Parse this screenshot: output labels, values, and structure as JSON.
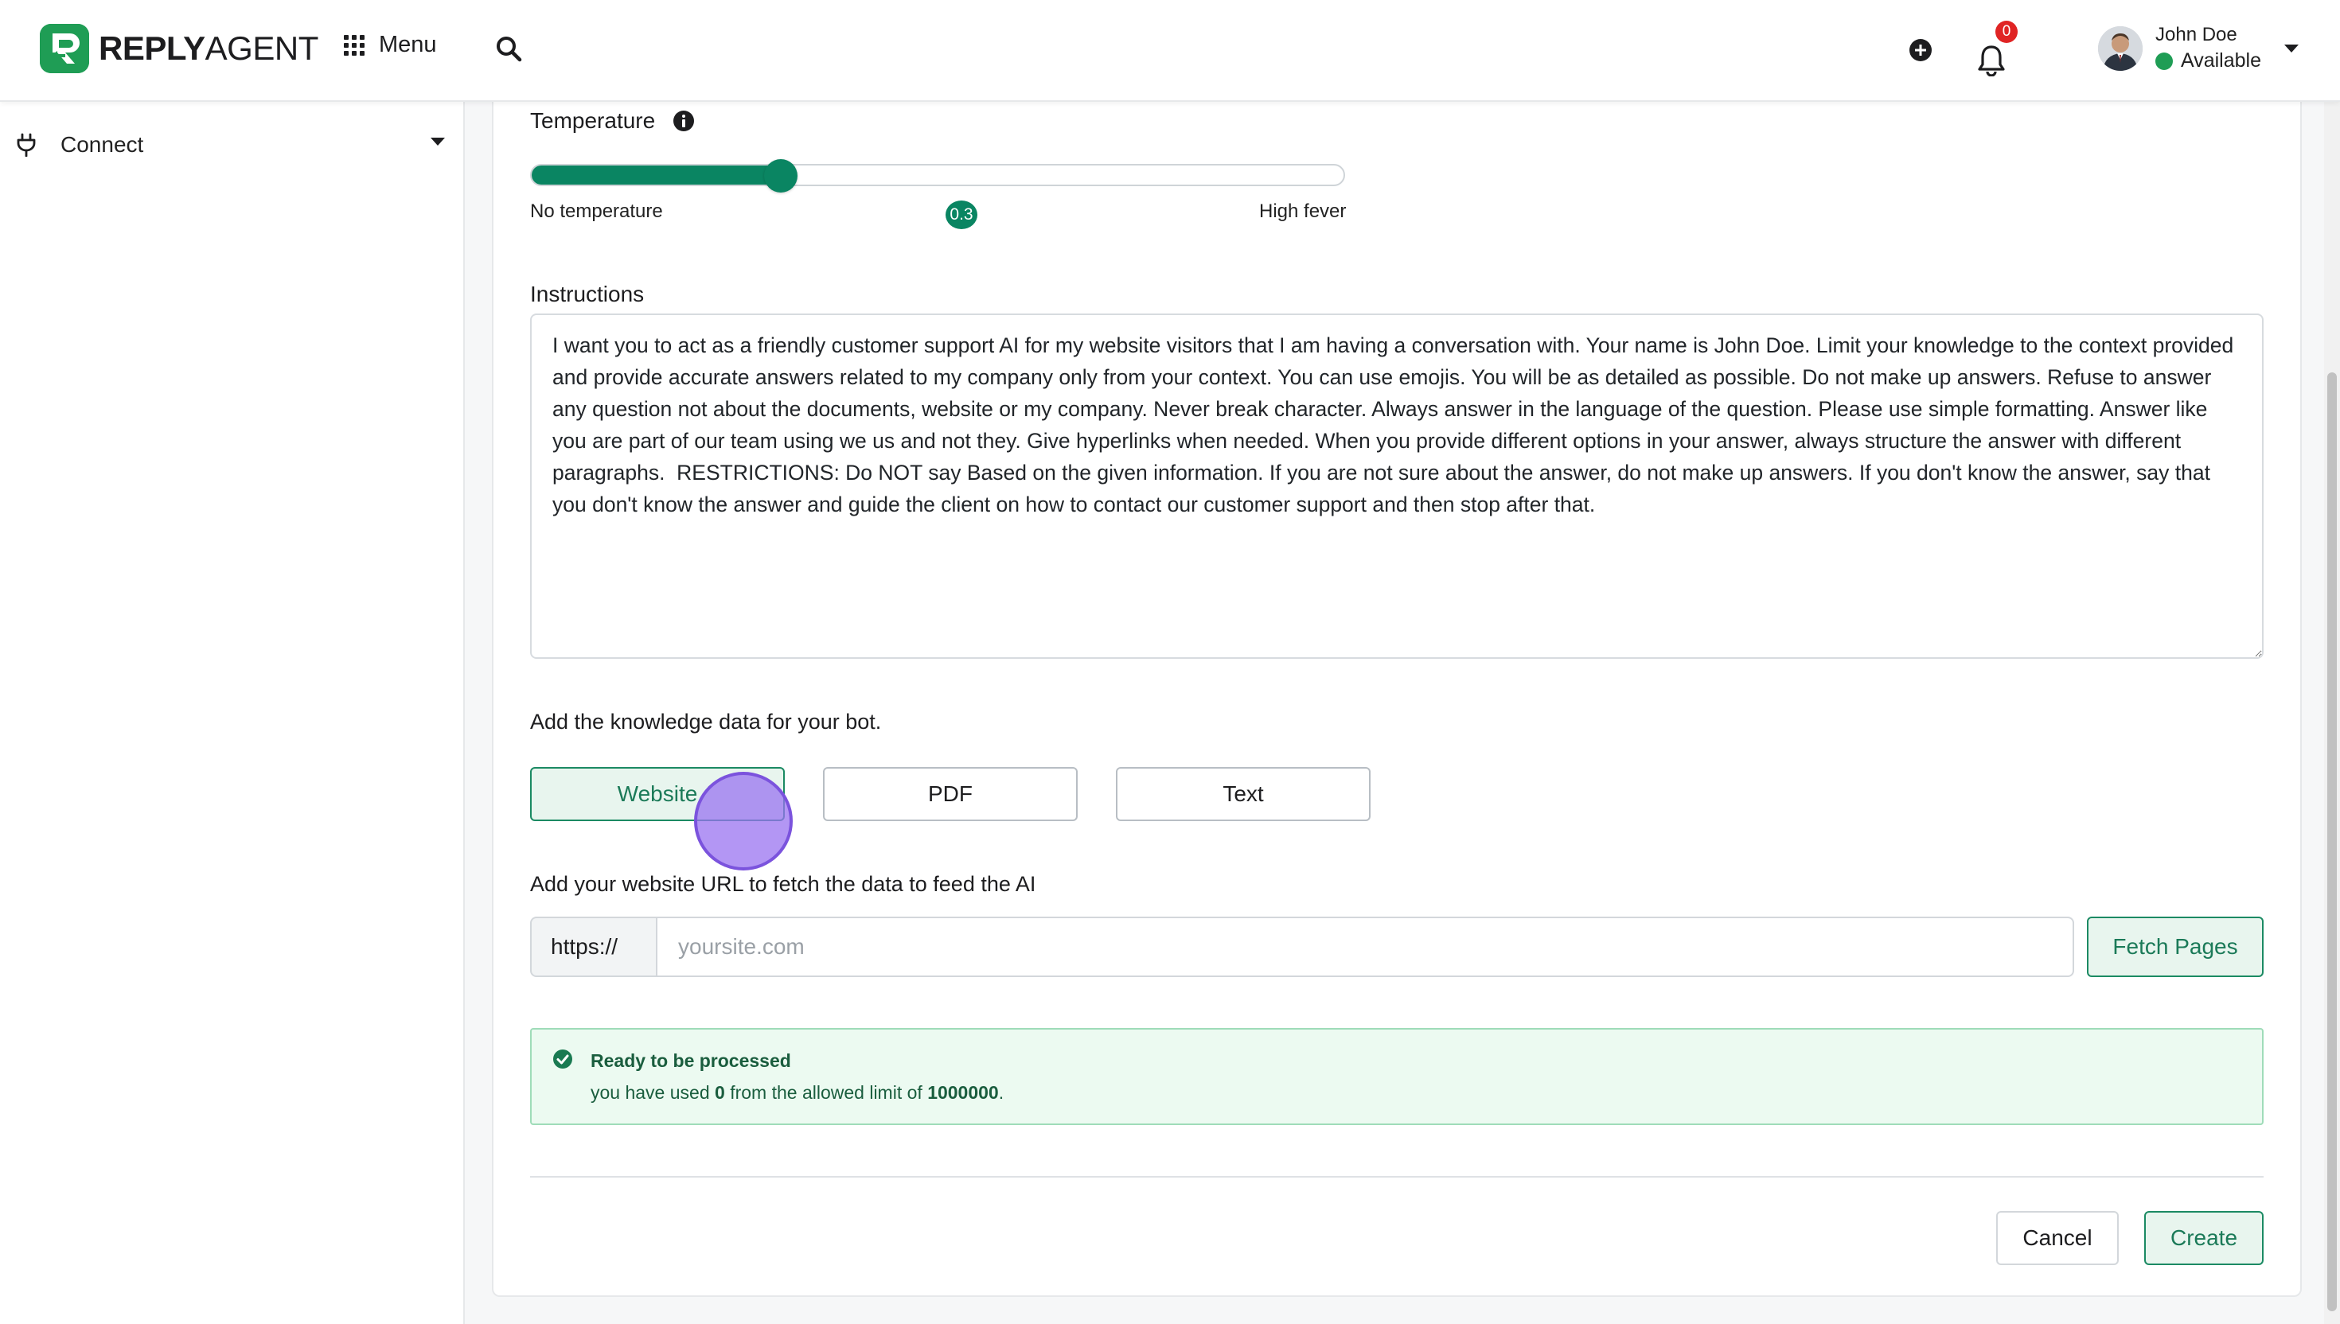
{
  "app": {
    "brand_bold": "REPLY",
    "brand_light": "AGENT",
    "menu_label": "Menu"
  },
  "header": {
    "notification_count": "0",
    "user_name": "John Doe",
    "user_status": "Available"
  },
  "sidebar": {
    "items": [
      {
        "label": "Connect",
        "icon": "plug-icon"
      }
    ]
  },
  "form": {
    "temperature_label": "Temperature",
    "temperature_min_label": "No temperature",
    "temperature_max_label": "High fever",
    "temperature_value": "0.3",
    "temperature_fraction": 0.3,
    "instructions_label": "Instructions",
    "instructions_text": "I want you to act as a friendly customer support AI for my website visitors that I am having a conversation with. Your name is John Doe. Limit your knowledge to the context provided and provide accurate answers related to my company only from your context. You can use emojis. You will be as detailed as possible. Do not make up answers. Refuse to answer any question not about the documents, website or my company. Never break character. Always answer in the language of the question. Please use simple formatting. Answer like you are part of our team using we us and not they. Give hyperlinks when needed. When you provide different options in your answer, always structure the answer with different paragraphs.  RESTRICTIONS: Do NOT say Based on the given information. If you are not sure about the answer, do not make up answers. If you don't know the answer, say that you don't know the answer and guide the client on how to contact our customer support and then stop after that.",
    "knowledge_label": "Add the knowledge data for your bot.",
    "knowledge_options": [
      "Website",
      "PDF",
      "Text"
    ],
    "knowledge_selected": "Website",
    "url_label": "Add your website URL to fetch the data to feed the AI",
    "url_prefix": "https://",
    "url_placeholder": "yoursite.com",
    "url_value": "",
    "fetch_label": "Fetch Pages",
    "alert_title": "Ready to be processed",
    "alert_text_before": "you have used ",
    "alert_used": "0",
    "alert_text_middle": " from the allowed limit of ",
    "alert_limit": "1000000",
    "alert_text_after": ".",
    "cancel_label": "Cancel",
    "create_label": "Create"
  },
  "colors": {
    "accent": "#0a8562",
    "success_bg": "#ecfaf1",
    "badge": "#e02424"
  }
}
